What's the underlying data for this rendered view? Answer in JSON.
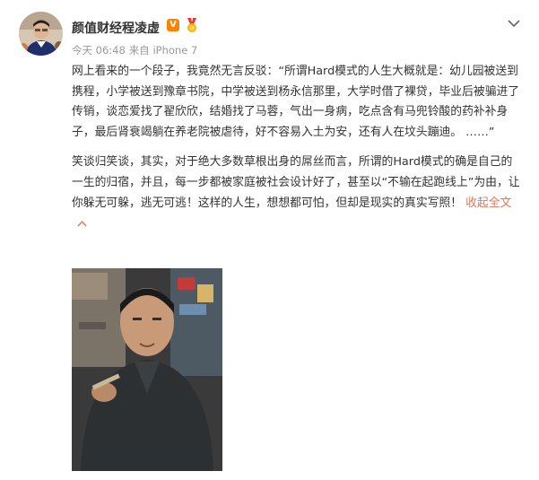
{
  "post": {
    "author": "颜值财经程凌虚",
    "verified_badge": "V",
    "time": "今天 06:48",
    "source": "来自 iPhone 7",
    "paragraph1": "网上看来的一个段子，我竟然无言反驳：“所谓Hard模式的人生大概就是：幼儿园被送到携程，小学被送到豫章书院，中学被送到杨永信那里，大学时借了裸贷，毕业后被骗进了传销，谈恋爱找了翟欣欣，结婚找了马蓉，气出一身病，吃点含有马兜铃酸的药补补身子，最后肾衰竭躺在养老院被虐待，好不容易入土为安，还有人在坟头蹦迪。 ……”",
    "paragraph2": "笑谈归笑谈，其实，对于绝大多数草根出身的屌丝而言，所谓的Hard模式的确是自己的一生的归宿，并且，每一步都被家庭被社会设计好了，甚至以“不输在起跑线上”为由，让你躲无可躲，逃无可逃！这样的人生，想想都可怕，但却是现实的真实写照！",
    "collapse_label": "收起全文"
  },
  "icons": {
    "avatar": "avatar",
    "badge": "vip-badge-icon",
    "medal": "medal-icon",
    "more": "chevron-down-icon",
    "collapse": "chevron-up-icon"
  },
  "colors": {
    "text": "#333333",
    "meta": "#999999",
    "link": "#eb7350",
    "badge": "#ff8200"
  }
}
